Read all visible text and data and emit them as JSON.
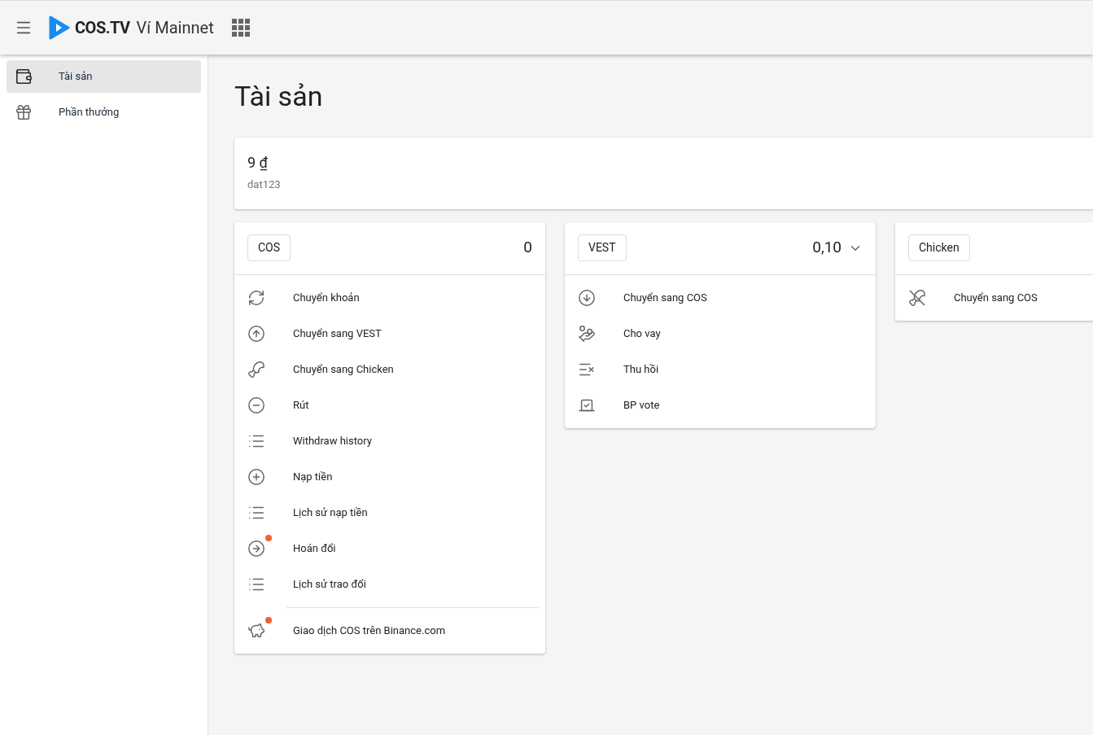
{
  "header": {
    "brand": "COS.TV",
    "title": "Ví Mainnet"
  },
  "sidebar": {
    "items": [
      {
        "label": "Tài sản",
        "selected": true
      },
      {
        "label": "Phần thưởng",
        "selected": false
      }
    ]
  },
  "page_title": "Tài sản",
  "balance": {
    "amount": "9 ₫",
    "account": "dat123"
  },
  "cards": [
    {
      "token": "COS",
      "value": "0",
      "expandable": false,
      "actions": [
        {
          "label": "Chuyển khoản",
          "badge": false,
          "divider_before": false
        },
        {
          "label": "Chuyển sang VEST",
          "badge": false,
          "divider_before": false
        },
        {
          "label": "Chuyển sang Chicken",
          "badge": false,
          "divider_before": false
        },
        {
          "label": "Rút",
          "badge": false,
          "divider_before": false
        },
        {
          "label": "Withdraw history",
          "badge": false,
          "divider_before": false
        },
        {
          "label": "Nạp tiền",
          "badge": false,
          "divider_before": false
        },
        {
          "label": "Lịch sử nạp tiền",
          "badge": false,
          "divider_before": false
        },
        {
          "label": "Hoán đổi",
          "badge": true,
          "divider_before": false
        },
        {
          "label": "Lịch sử trao đổi",
          "badge": false,
          "divider_before": false
        },
        {
          "label": "Giao dịch COS trên Binance.com",
          "badge": true,
          "divider_before": true
        }
      ]
    },
    {
      "token": "VEST",
      "value": "0,10",
      "expandable": true,
      "actions": [
        {
          "label": "Chuyển sang COS",
          "badge": false,
          "divider_before": false
        },
        {
          "label": "Cho vay",
          "badge": false,
          "divider_before": false
        },
        {
          "label": "Thu hồi",
          "badge": false,
          "divider_before": false
        },
        {
          "label": "BP vote",
          "badge": false,
          "divider_before": false
        }
      ]
    },
    {
      "token": "Chicken",
      "expandable": false,
      "actions": [
        {
          "label": "Chuyển sang COS",
          "badge": false,
          "divider_before": false
        }
      ]
    }
  ]
}
